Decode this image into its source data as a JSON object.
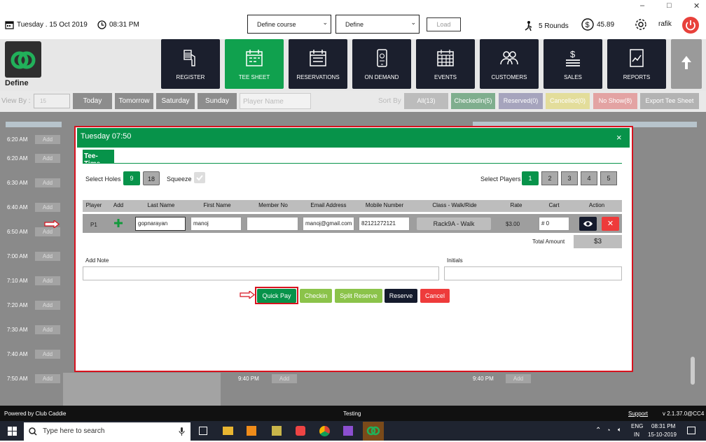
{
  "window": {
    "minimize": "–",
    "maximize": "□",
    "close": "✕"
  },
  "topbar": {
    "date": "Tuesday . 15 Oct 2019",
    "time": "08:31 PM",
    "course_select": "Define course",
    "define_select": "Define",
    "load_label": "Load",
    "rounds": "5 Rounds",
    "balance": "45.89",
    "user": "rafik"
  },
  "brand": {
    "name": "Define"
  },
  "nav": [
    {
      "label": "REGISTER",
      "icon": "barcode-scanner-icon"
    },
    {
      "label": "TEE SHEET",
      "icon": "calendar-icon",
      "active": true
    },
    {
      "label": "RESERVATIONS",
      "icon": "calendar-icon"
    },
    {
      "label": "ON DEMAND",
      "icon": "mobile-icon"
    },
    {
      "label": "EVENTS",
      "icon": "calendar-grid-icon"
    },
    {
      "label": "CUSTOMERS",
      "icon": "users-icon"
    },
    {
      "label": "SALES",
      "icon": "money-icon"
    },
    {
      "label": "REPORTS",
      "icon": "report-icon"
    }
  ],
  "filter": {
    "view_by": "View By :",
    "date_value": "15",
    "days": [
      "Today",
      "Tomorrow",
      "Saturday",
      "Sunday"
    ],
    "player_placeholder": "Player Name",
    "sort_by": "Sort By",
    "sort_buttons": [
      "All(13)",
      "CheckedIn(5)",
      "Reserved(0)",
      "Cancelled(0)",
      "No Show(8)",
      "Export Tee Sheet"
    ]
  },
  "sheet": {
    "times": [
      "6:20 AM",
      "6:30 AM",
      "6:40 AM",
      "6:50 AM",
      "7:00 AM",
      "7:10 AM",
      "7:20 AM",
      "7:30 AM",
      "7:40 AM",
      "7:50 AM"
    ],
    "add_label": "Add",
    "late_time": "9:40 PM"
  },
  "modal": {
    "title": "Tuesday 07:50",
    "close": "×",
    "tab": "Tee-Time",
    "select_holes_label": "Select Holes",
    "holes": [
      "9",
      "18"
    ],
    "squeeze_label": "Squeeze",
    "select_players_label": "Select Players",
    "players": [
      "1",
      "2",
      "3",
      "4",
      "5"
    ],
    "columns": [
      "Player",
      "Add",
      "Last Name",
      "First Name",
      "Member No",
      "Email Address",
      "Mobile Number",
      "Class - Walk/Ride",
      "Rate",
      "Cart",
      "Action"
    ],
    "row": {
      "player": "P1",
      "last_name": "gopnarayan",
      "first_name": "manoj",
      "member_no": "",
      "email": "manoj@gmail.com",
      "mobile": "82121272121",
      "class": "Rack9A - Walk",
      "rate": "$3.00",
      "cart": "# 0"
    },
    "total_label": "Total Amount",
    "total_value": "$3",
    "add_note_label": "Add Note",
    "initials_label": "Initials",
    "buttons": {
      "quick_pay": "Quick Pay",
      "checkin": "Checkin",
      "split_reserve": "Split Reserve",
      "reserve": "Reserve",
      "cancel": "Cancel"
    }
  },
  "footer": {
    "powered": "Powered by Club Caddie",
    "env": "Testing",
    "support": "Support",
    "version": "v 2.1.37.0@CC4"
  },
  "taskbar": {
    "search_placeholder": "Type here to search",
    "lang1": "ENG",
    "lang2": "IN",
    "time": "08:31 PM",
    "date": "15-10-2019"
  },
  "colors": {
    "green": "#07934a",
    "nav_dark": "#1b1f2d",
    "red": "#d7121e",
    "light_green": "#8bc34a"
  }
}
